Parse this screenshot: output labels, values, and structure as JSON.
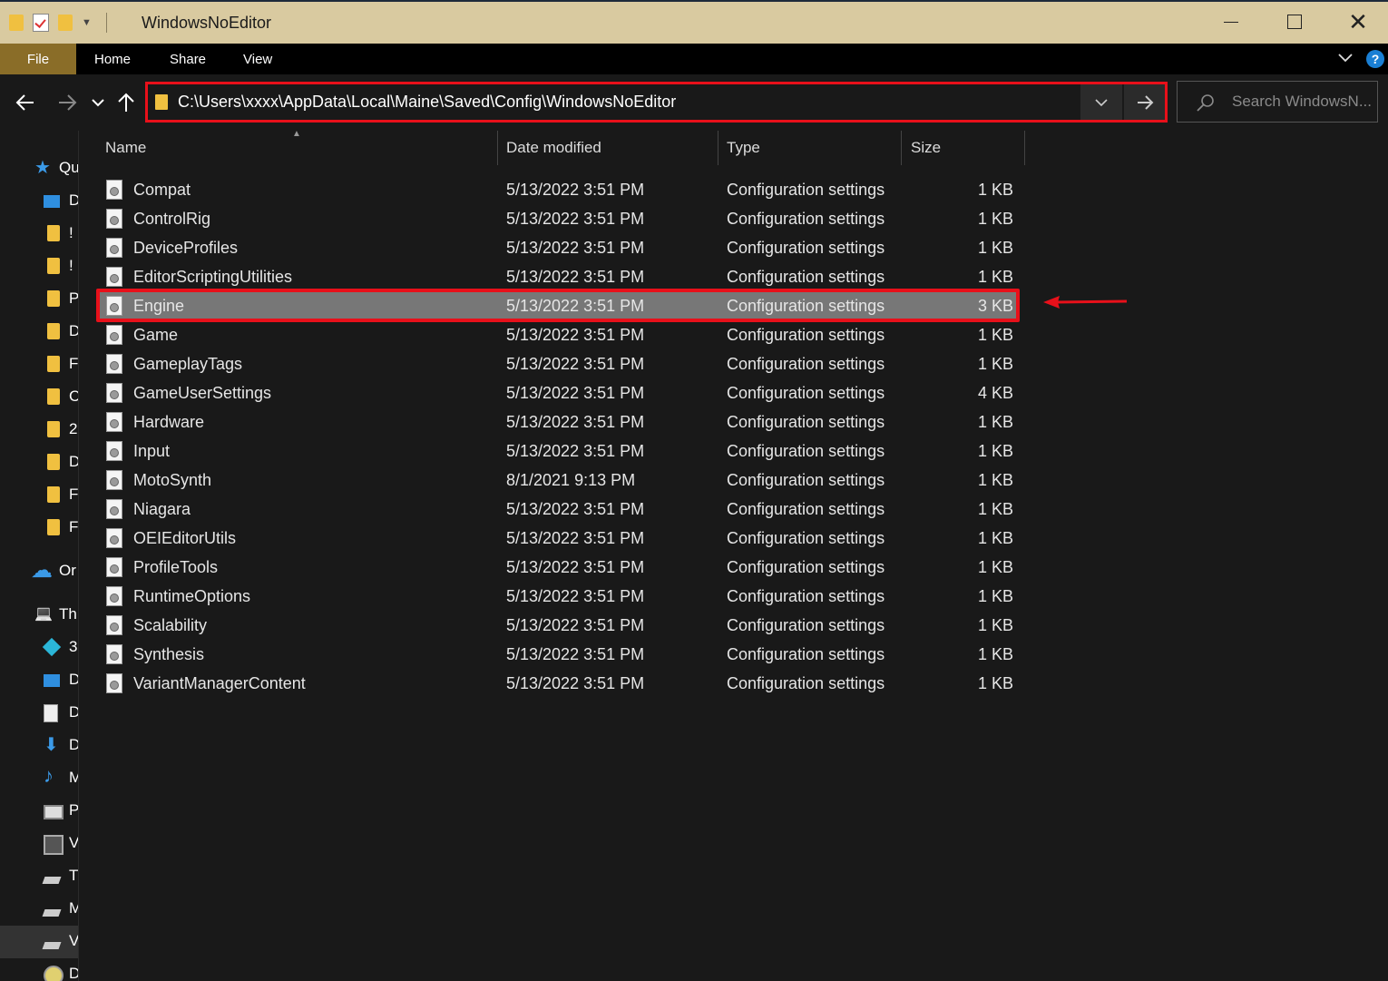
{
  "window": {
    "title": "WindowsNoEditor",
    "minimize_icon": "minimize-icon",
    "maximize_icon": "maximize-icon",
    "close_icon": "close-icon"
  },
  "ribbon": {
    "tabs": [
      "File",
      "Home",
      "Share",
      "View"
    ],
    "help": "?"
  },
  "address_bar": {
    "path": "C:\\Users\\xxxx\\AppData\\Local\\Maine\\Saved\\Config\\WindowsNoEditor"
  },
  "search": {
    "placeholder": "Search WindowsN..."
  },
  "nav_pane": {
    "items": [
      {
        "label": "Qu",
        "icon": "star-icon"
      },
      {
        "label": "D",
        "icon": "desktop-icon"
      },
      {
        "label": "!",
        "icon": "folder-icon"
      },
      {
        "label": "!",
        "icon": "folder-icon"
      },
      {
        "label": "P",
        "icon": "folder-icon"
      },
      {
        "label": "D",
        "icon": "folder-icon"
      },
      {
        "label": "F",
        "icon": "folder-icon"
      },
      {
        "label": "C",
        "icon": "folder-icon"
      },
      {
        "label": "2",
        "icon": "folder-icon"
      },
      {
        "label": "D",
        "icon": "folder-icon"
      },
      {
        "label": "F",
        "icon": "folder-icon"
      },
      {
        "label": "F",
        "icon": "folder-icon"
      },
      {
        "label": "Or",
        "icon": "onedrive-icon"
      },
      {
        "label": "Th",
        "icon": "this-pc-icon"
      },
      {
        "label": "3",
        "icon": "3d-objects-icon"
      },
      {
        "label": "D",
        "icon": "desktop-icon"
      },
      {
        "label": "D",
        "icon": "documents-icon"
      },
      {
        "label": "D",
        "icon": "downloads-icon"
      },
      {
        "label": "M",
        "icon": "music-icon"
      },
      {
        "label": "P",
        "icon": "pictures-icon"
      },
      {
        "label": "V",
        "icon": "videos-icon"
      },
      {
        "label": "T",
        "icon": "drive-icon"
      },
      {
        "label": "M",
        "icon": "drive-icon"
      },
      {
        "label": "V",
        "icon": "drive-icon"
      },
      {
        "label": "D",
        "icon": "disc-icon"
      }
    ]
  },
  "columns": {
    "name": "Name",
    "date": "Date modified",
    "type": "Type",
    "size": "Size"
  },
  "files": [
    {
      "name": "Compat",
      "date": "5/13/2022 3:51 PM",
      "type": "Configuration settings",
      "size": "1 KB"
    },
    {
      "name": "ControlRig",
      "date": "5/13/2022 3:51 PM",
      "type": "Configuration settings",
      "size": "1 KB"
    },
    {
      "name": "DeviceProfiles",
      "date": "5/13/2022 3:51 PM",
      "type": "Configuration settings",
      "size": "1 KB"
    },
    {
      "name": "EditorScriptingUtilities",
      "date": "5/13/2022 3:51 PM",
      "type": "Configuration settings",
      "size": "1 KB"
    },
    {
      "name": "Engine",
      "date": "5/13/2022 3:51 PM",
      "type": "Configuration settings",
      "size": "3 KB",
      "selected": true
    },
    {
      "name": "Game",
      "date": "5/13/2022 3:51 PM",
      "type": "Configuration settings",
      "size": "1 KB"
    },
    {
      "name": "GameplayTags",
      "date": "5/13/2022 3:51 PM",
      "type": "Configuration settings",
      "size": "1 KB"
    },
    {
      "name": "GameUserSettings",
      "date": "5/13/2022 3:51 PM",
      "type": "Configuration settings",
      "size": "4 KB"
    },
    {
      "name": "Hardware",
      "date": "5/13/2022 3:51 PM",
      "type": "Configuration settings",
      "size": "1 KB"
    },
    {
      "name": "Input",
      "date": "5/13/2022 3:51 PM",
      "type": "Configuration settings",
      "size": "1 KB"
    },
    {
      "name": "MotoSynth",
      "date": "8/1/2021 9:13 PM",
      "type": "Configuration settings",
      "size": "1 KB"
    },
    {
      "name": "Niagara",
      "date": "5/13/2022 3:51 PM",
      "type": "Configuration settings",
      "size": "1 KB"
    },
    {
      "name": "OEIEditorUtils",
      "date": "5/13/2022 3:51 PM",
      "type": "Configuration settings",
      "size": "1 KB"
    },
    {
      "name": "ProfileTools",
      "date": "5/13/2022 3:51 PM",
      "type": "Configuration settings",
      "size": "1 KB"
    },
    {
      "name": "RuntimeOptions",
      "date": "5/13/2022 3:51 PM",
      "type": "Configuration settings",
      "size": "1 KB"
    },
    {
      "name": "Scalability",
      "date": "5/13/2022 3:51 PM",
      "type": "Configuration settings",
      "size": "1 KB"
    },
    {
      "name": "Synthesis",
      "date": "5/13/2022 3:51 PM",
      "type": "Configuration settings",
      "size": "1 KB"
    },
    {
      "name": "VariantManagerContent",
      "date": "5/13/2022 3:51 PM",
      "type": "Configuration settings",
      "size": "1 KB"
    }
  ],
  "colors": {
    "annotation": "#e8101a",
    "file_tab": "#8a6d28",
    "titlebar": "#d9caa0",
    "selected_row": "#777777"
  }
}
